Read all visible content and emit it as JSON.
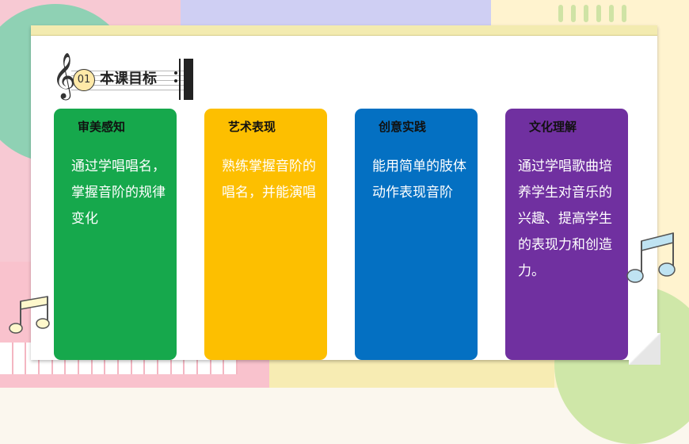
{
  "heading": {
    "number": "01",
    "title": "本课目标"
  },
  "cards": [
    {
      "title": "审美感知",
      "body": "通过学唱唱名，掌握音阶的规律变化",
      "color": "#16a84c"
    },
    {
      "title": "艺术表现",
      "body": "熟练掌握音阶的唱名，并能演唱",
      "color": "#fdbf00"
    },
    {
      "title": "创意实践",
      "body": "能用简单的肢体动作表现音阶",
      "color": "#0470c2"
    },
    {
      "title": "文化理解",
      "body": "通过学唱歌曲培养学生对音乐的兴趣、提高学生的表现力和创造力。",
      "color": "#7030a0"
    }
  ],
  "icons": [
    "treble-clef-icon",
    "music-note-icon"
  ]
}
